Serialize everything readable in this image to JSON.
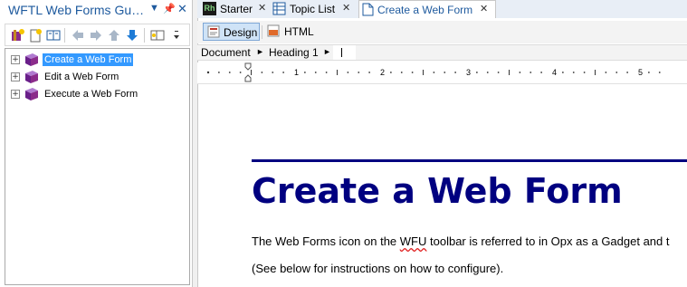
{
  "left_panel": {
    "title": "WFTL Web Forms Gu…",
    "tree": [
      {
        "label": "Create a Web Form",
        "selected": true
      },
      {
        "label": "Edit a Web Form",
        "selected": false
      },
      {
        "label": "Execute a Web Form",
        "selected": false
      }
    ]
  },
  "tabs": [
    {
      "icon_text": "Rh",
      "label": "Starter",
      "close": "✕"
    },
    {
      "label": "Topic List",
      "close": "✕"
    },
    {
      "label": "Create a Web Form",
      "close": "✕"
    }
  ],
  "view_buttons": {
    "design": "Design",
    "html": "HTML"
  },
  "breadcrumb": {
    "document": "Document",
    "heading": "Heading 1"
  },
  "ruler": {
    "labels": [
      "1",
      "2",
      "3",
      "4",
      "5"
    ]
  },
  "document": {
    "title": "Create a Web Form",
    "para1_a": "The Web Forms icon on the ",
    "para1_b": "WFU",
    "para1_c": " toolbar is referred to in Opx as a Gadget and t",
    "para2": "(See below for instructions on how to configure)."
  },
  "colors": {
    "accent": "#1e5a9e",
    "heading": "#000080",
    "selection": "#3399ff"
  }
}
